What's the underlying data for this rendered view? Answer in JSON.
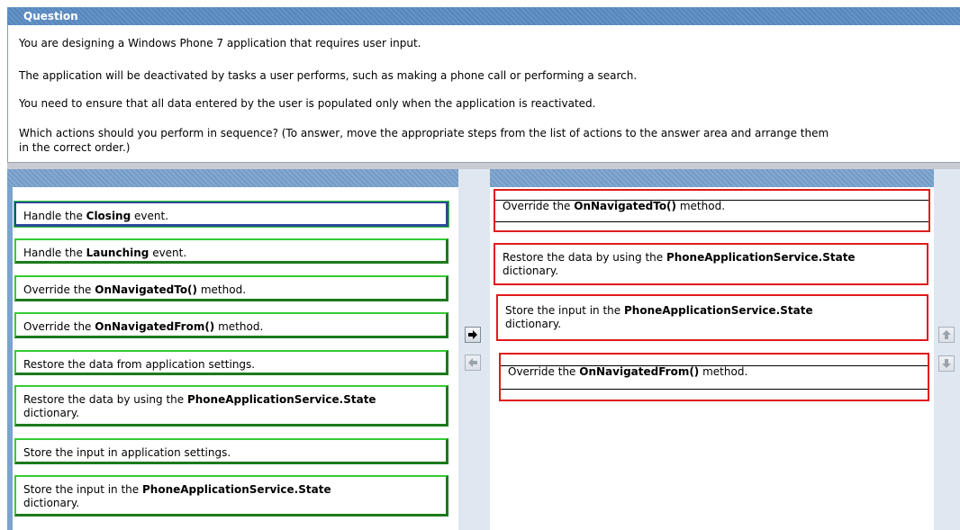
{
  "question": {
    "title": "Question",
    "lines": [
      "You are designing a Windows Phone 7 application that requires user input.",
      "The application will be deactivated by tasks a user performs, such as making a phone call or performing a search.",
      "You need to ensure that all data entered by the user is populated only when the application is reactivated.",
      "Which actions should you perform in sequence? (To answer, move the appropriate steps from the list of actions to the answer area and arrange them",
      "in the correct order.)"
    ]
  },
  "actions": [
    {
      "pre": "Handle the ",
      "bold": "Closing",
      "post": " event.",
      "pre2": "",
      "selected": true
    },
    {
      "pre": "Handle the ",
      "bold": "Launching",
      "post": " event.",
      "pre2": "",
      "selected": false
    },
    {
      "pre": "Override the ",
      "bold": "OnNavigatedTo()",
      "post": " method.",
      "pre2": "",
      "selected": false
    },
    {
      "pre": "Override the ",
      "bold": "OnNavigatedFrom()",
      "post": " method.",
      "pre2": "",
      "selected": false
    },
    {
      "pre": "Restore the data from application settings.",
      "bold": "",
      "post": "",
      "pre2": "",
      "selected": false
    },
    {
      "pre": "Restore the data by using the ",
      "bold": "PhoneApplicationService.State",
      "post": "",
      "pre2": "dictionary.",
      "selected": false
    },
    {
      "pre": "Store the input in application settings.",
      "bold": "",
      "post": "",
      "pre2": "",
      "selected": false
    },
    {
      "pre": "Store the input in the ",
      "bold": "PhoneApplicationService.State",
      "post": "",
      "pre2": "dictionary.",
      "selected": false
    }
  ],
  "answers": [
    {
      "pre": "Override the ",
      "bold": "OnNavigatedTo()",
      "post": " method.",
      "pre2": ""
    },
    {
      "pre": "Restore the data by using the ",
      "bold": "PhoneApplicationService.State",
      "post": "",
      "pre2": "dictionary."
    },
    {
      "pre": "Store the input in the ",
      "bold": "PhoneApplicationService.State",
      "post": "",
      "pre2": "dictionary."
    },
    {
      "pre": "Override the ",
      "bold": "OnNavigatedFrom()",
      "post": " method.",
      "pre2": ""
    }
  ],
  "buttons": {
    "move_right": "right-arrow-icon",
    "move_left": "left-arrow-icon",
    "move_up": "up-arrow-icon",
    "move_down": "down-arrow-icon"
  },
  "colors": {
    "header_blue": "#5b8cc4",
    "panel_blue": "#7aa3cf",
    "left_border_green": "#33cc33",
    "answer_border_red": "#e01b1b"
  }
}
